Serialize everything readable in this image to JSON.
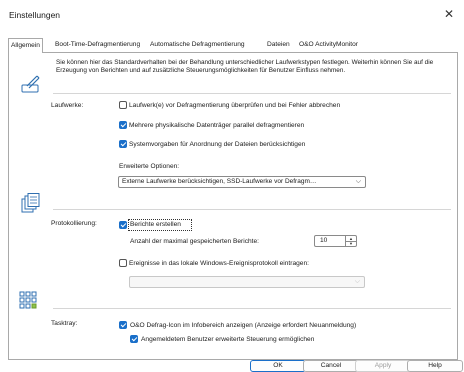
{
  "window": {
    "title": "Einstellungen",
    "close_glyph": "✕"
  },
  "tabs": [
    "Allgemein",
    "Boot-Time-Defragmentierung",
    "Automatische Defragmentierung",
    "Dateien",
    "O&O ActivityMonitor"
  ],
  "description": "Sie können hier das Standardverhalten bei der Behandlung unterschiedlicher Laufwerkstypen festlegen. Weiterhin können Sie auf die Erzeugung von Berichten und auf zusätzliche Steuerungsmöglichkeiten für Benutzer Einfluss nehmen.",
  "drives": {
    "label": "Laufwerke:",
    "options": [
      {
        "label": "Laufwerk(e) vor Defragmentierung überprüfen und bei Fehler abbrechen",
        "checked": false
      },
      {
        "label": "Mehrere physikalische Datenträger parallel defragmentieren",
        "checked": true
      },
      {
        "label": "Systemvorgaben für Anordnung der Dateien berücksichtigen",
        "checked": true
      }
    ],
    "extended_label": "Erweiterte Optionen:",
    "extended_value": "Externe Laufwerke berücksichtigen, SSD-Laufwerke vor Defragm…"
  },
  "logging": {
    "label": "Protokollierung:",
    "create_reports": {
      "label": "Berichte erstellen",
      "checked": true
    },
    "max_reports_label": "Anzahl der maximal gespeicherten Berichte:",
    "max_reports_value": "10",
    "eventlog": {
      "label": "Ereignisse in das lokale Windows-Ereignisprotokoll eintragen:",
      "checked": false
    },
    "eventlog_select_value": ""
  },
  "tasktray": {
    "label": "Tasktray:",
    "show_icon": {
      "label": "O&O Defrag-Icon im Infobereich anzeigen (Anzeige erfordert Neuanmeldung)",
      "checked": true
    },
    "extended_control": {
      "label": "Angemeldetem Benutzer erweiterte Steuerung ermöglichen",
      "checked": true
    }
  },
  "buttons": {
    "ok": "OK",
    "cancel": "Cancel",
    "apply": "Apply",
    "help": "Help"
  },
  "icons": {
    "general": "pen-settings-icon",
    "drives": "drives-stack-icon",
    "logging": "report-grid-icon",
    "tasktray": "tray-grid-icon",
    "chevron": "chevron-down-icon"
  },
  "colors": {
    "accent": "#1a6fc9",
    "icon_stroke": "#2f6fb0"
  }
}
